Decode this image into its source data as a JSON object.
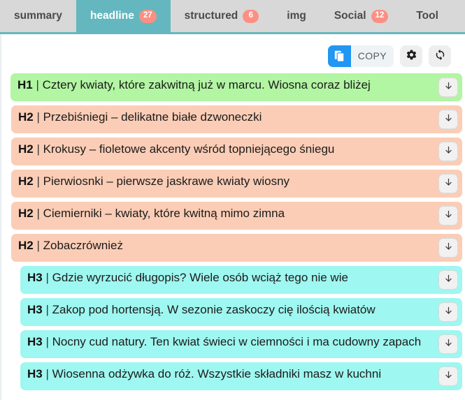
{
  "tabs": [
    {
      "label": "summary",
      "badge": null,
      "active": false,
      "name": "tab-summary"
    },
    {
      "label": "headline",
      "badge": "27",
      "active": true,
      "name": "tab-headline"
    },
    {
      "label": "structured",
      "badge": "6",
      "active": false,
      "name": "tab-structured"
    },
    {
      "label": "img",
      "badge": null,
      "active": false,
      "name": "tab-img"
    },
    {
      "label": "Social",
      "badge": "12",
      "active": false,
      "name": "tab-social"
    },
    {
      "label": "Tool",
      "badge": null,
      "active": false,
      "name": "tab-tool"
    }
  ],
  "toolbar": {
    "copy_label": "COPY",
    "copy_icon": "copy-document-icon",
    "settings_icon": "gear-icon",
    "refresh_icon": "refresh-sync-icon"
  },
  "colors": {
    "tabbar_bg": "#d8d8d8",
    "active_tab": "#64b7be",
    "badge": "#fc8f83",
    "h1_bg": "#b2f5a2",
    "h2_bg": "#fbcdb6",
    "h3_bg": "#9ef7f0",
    "copy_accent": "#2196f3"
  },
  "row_action_icon": "arrow-down-icon",
  "headings": [
    {
      "tag": "H1",
      "sep": "|",
      "text": "Cztery kwiaty, które zakwitną już w marcu. Wiosna coraz bliżej",
      "level": "h1"
    },
    {
      "tag": "H2",
      "sep": "|",
      "text": "Przebiśniegi – delikatne białe dzwoneczki",
      "level": "h2"
    },
    {
      "tag": "H2",
      "sep": "|",
      "text": "Krokusy – fioletowe akcenty wśród topniejącego śniegu",
      "level": "h2"
    },
    {
      "tag": "H2",
      "sep": "|",
      "text": "Pierwiosnki – pierwsze jaskrawe kwiaty wiosny",
      "level": "h2"
    },
    {
      "tag": "H2",
      "sep": "|",
      "text": "Ciemierniki – kwiaty, które kwitną mimo zimna",
      "level": "h2"
    },
    {
      "tag": "H2",
      "sep": "|",
      "text": "Zobaczrównież",
      "level": "h2"
    },
    {
      "tag": "H3",
      "sep": "|",
      "text": "Gdzie wyrzucić długopis? Wiele osób wciąż tego nie wie",
      "level": "h3"
    },
    {
      "tag": "H3",
      "sep": "|",
      "text": "Zakop pod hortensją. W sezonie zaskoczy cię ilością kwiatów",
      "level": "h3"
    },
    {
      "tag": "H3",
      "sep": "|",
      "text": "Nocny cud natury. Ten kwiat świeci w ciemności i ma cudowny zapach",
      "level": "h3"
    },
    {
      "tag": "H3",
      "sep": "|",
      "text": "Wiosenna odżywka do róż. Wszystkie składniki masz w kuchni",
      "level": "h3"
    }
  ]
}
